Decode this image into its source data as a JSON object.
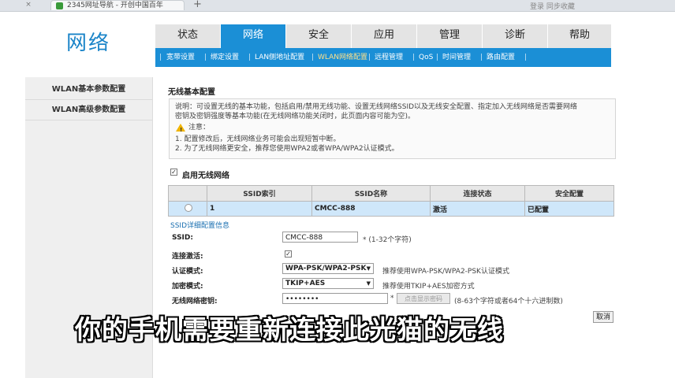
{
  "browser": {
    "tab_title": "2345网址导航 - 开创中国百年",
    "new_tab": "+",
    "close": "×",
    "user_info": "登录 同步收藏"
  },
  "header": {
    "brand": "网络",
    "tabs": [
      "状态",
      "网络",
      "安全",
      "应用",
      "管理",
      "诊断",
      "帮助"
    ],
    "active_tab": "网络"
  },
  "subnav": {
    "items": [
      "宽带设置",
      "绑定设置",
      "LAN侧地址配置",
      "WLAN网络配置",
      "远程管理",
      "QoS",
      "时间管理",
      "路由配置"
    ],
    "active": "WLAN网络配置"
  },
  "sidebar": {
    "items": [
      "WLAN基本参数配置",
      "WLAN高级参数配置"
    ]
  },
  "main": {
    "section_title": "无线基本配置",
    "info_line1": "说明：可设置无线的基本功能，包括启用/禁用无线功能、设置无线网络SSID以及无线安全配置、指定加入无线网络是否需要网络",
    "info_line2": "密钥及密钥强度等基本功能(在无线网络功能关闭时，此页面内容可能为空)。",
    "notice_title": "注意：",
    "notice1": "1. 配置修改后，无线网络业务可能会出现短暂中断。",
    "notice2": "2. 为了无线网络更安全，推荐您使用WPA2或者WPA/WPA2认证模式。",
    "enable_label": "启用无线网络",
    "enable_checked": true,
    "table": {
      "headers": [
        "SSID索引",
        "SSID名称",
        "连接状态",
        "安全配置"
      ],
      "rows": [
        [
          "1",
          "CMCC-888",
          "激活",
          "已配置"
        ]
      ]
    },
    "detail_title": "SSID详细配置信息",
    "fields": {
      "ssid_label": "SSID:",
      "ssid_value": "CMCC-888",
      "ssid_hint": "* (1-32个字符)",
      "active_label": "连接激活:",
      "active_checked": true,
      "auth_label": "认证模式:",
      "auth_value": "WPA-PSK/WPA2-PSK",
      "auth_hint": "推荐使用WPA-PSK/WPA2-PSK认证模式",
      "enc_label": "加密模式:",
      "enc_value": "TKIP+AES",
      "enc_hint": "推荐使用TKIP+AES加密方式",
      "pwd_label": "无线网络密钥:",
      "pwd_value": "••••••••",
      "pwd_star": "*",
      "show_pwd": "点击显示密码",
      "pwd_hint": "(8-63个字符或者64个十六进制数)"
    },
    "cancel": "取消"
  },
  "subtitle": "你的手机需要重新连接此光猫的无线",
  "colors": {
    "accent": "#1b8fd6",
    "brand": "#1a84c8"
  }
}
